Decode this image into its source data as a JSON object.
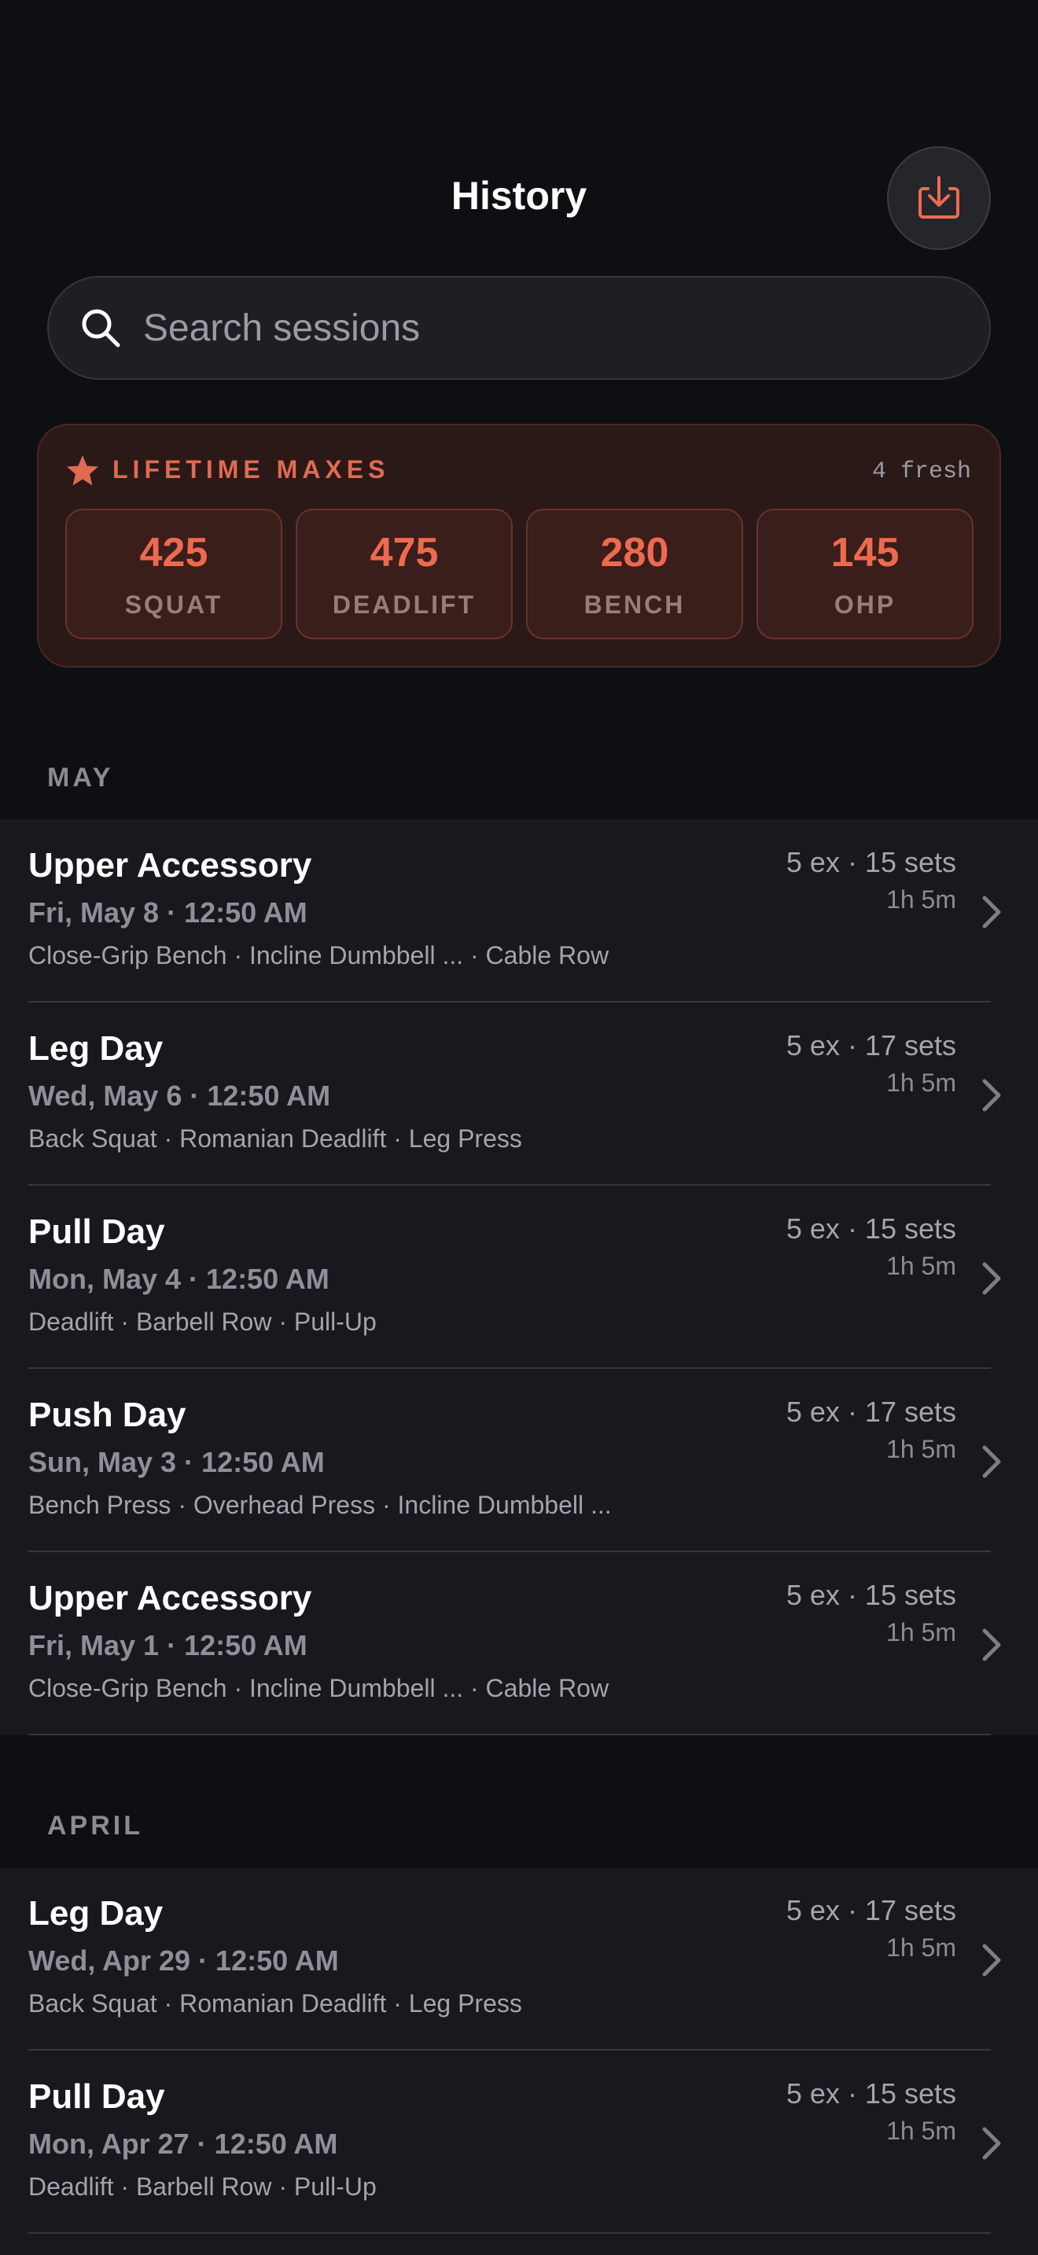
{
  "header": {
    "title": "History",
    "export_icon": "download-tray-icon"
  },
  "search": {
    "placeholder": "Search sessions",
    "icon": "search-icon"
  },
  "lifetime_maxes": {
    "title": "LIFETIME MAXES",
    "icon": "star-icon",
    "fresh_label": "4 fresh",
    "accent_color": "#e06a52",
    "items": [
      {
        "value": "425",
        "label": "SQUAT"
      },
      {
        "value": "475",
        "label": "DEADLIFT"
      },
      {
        "value": "280",
        "label": "BENCH"
      },
      {
        "value": "145",
        "label": "OHP"
      }
    ]
  },
  "sections": [
    {
      "month": "MAY",
      "sessions": [
        {
          "title": "Upper Accessory",
          "date": "Fri, May 8 · 12:50 AM",
          "exercises": "Close-Grip Bench · Incline Dumbbell ... · Cable Row",
          "stats": "5 ex · 15 sets",
          "duration": "1h 5m"
        },
        {
          "title": "Leg Day",
          "date": "Wed, May 6 · 12:50 AM",
          "exercises": "Back Squat · Romanian Deadlift · Leg Press",
          "stats": "5 ex · 17 sets",
          "duration": "1h 5m"
        },
        {
          "title": "Pull Day",
          "date": "Mon, May 4 · 12:50 AM",
          "exercises": "Deadlift · Barbell Row · Pull-Up",
          "stats": "5 ex · 15 sets",
          "duration": "1h 5m"
        },
        {
          "title": "Push Day",
          "date": "Sun, May 3 · 12:50 AM",
          "exercises": "Bench Press · Overhead Press · Incline Dumbbell ...",
          "stats": "5 ex · 17 sets",
          "duration": "1h 5m"
        },
        {
          "title": "Upper Accessory",
          "date": "Fri, May 1 · 12:50 AM",
          "exercises": "Close-Grip Bench · Incline Dumbbell ... · Cable Row",
          "stats": "5 ex · 15 sets",
          "duration": "1h 5m"
        }
      ]
    },
    {
      "month": "APRIL",
      "sessions": [
        {
          "title": "Leg Day",
          "date": "Wed, Apr 29 · 12:50 AM",
          "exercises": "Back Squat · Romanian Deadlift · Leg Press",
          "stats": "5 ex · 17 sets",
          "duration": "1h 5m"
        },
        {
          "title": "Pull Day",
          "date": "Mon, Apr 27 · 12:50 AM",
          "exercises": "Deadlift · Barbell Row · Pull-Up",
          "stats": "5 ex · 15 sets",
          "duration": "1h 5m"
        }
      ]
    }
  ]
}
